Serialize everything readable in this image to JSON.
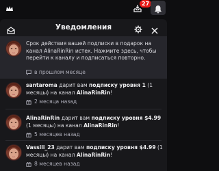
{
  "topbar": {
    "badge_count": "27"
  },
  "panel": {
    "title": "Уведомления"
  },
  "notifications": [
    {
      "text": "Срок действия вашей подписки в подарок на канал AlinaRinRin истек. Нажмите здесь, чтобы перейти к каналу и подписаться повторно.",
      "time": "в прошлом месяце",
      "unread": true
    },
    {
      "user": "santaroma",
      "t1": " дарит вам ",
      "bold1": "подписку уровня 1",
      "t2": " (1 месяцы) на канал ",
      "channel": "AlinaRinRin",
      "t3": "!",
      "time": "2 месяца назад"
    },
    {
      "user": "AlinaRinRin",
      "t1": " дарит вам ",
      "bold1": "подписку уровня $4.99",
      "t2": " (1 месяцы) на канал ",
      "channel": "AlinaRinRin",
      "t3": "!",
      "time": "5 месяцев назад"
    },
    {
      "user": "Vassili_23",
      "t1": " дарит вам ",
      "bold1": "подписку уровня $4.99",
      "t2": " (1 месяцы) на канал ",
      "channel": "AlinaRinRin",
      "t3": "!",
      "time": "8 месяцев назад"
    }
  ]
}
